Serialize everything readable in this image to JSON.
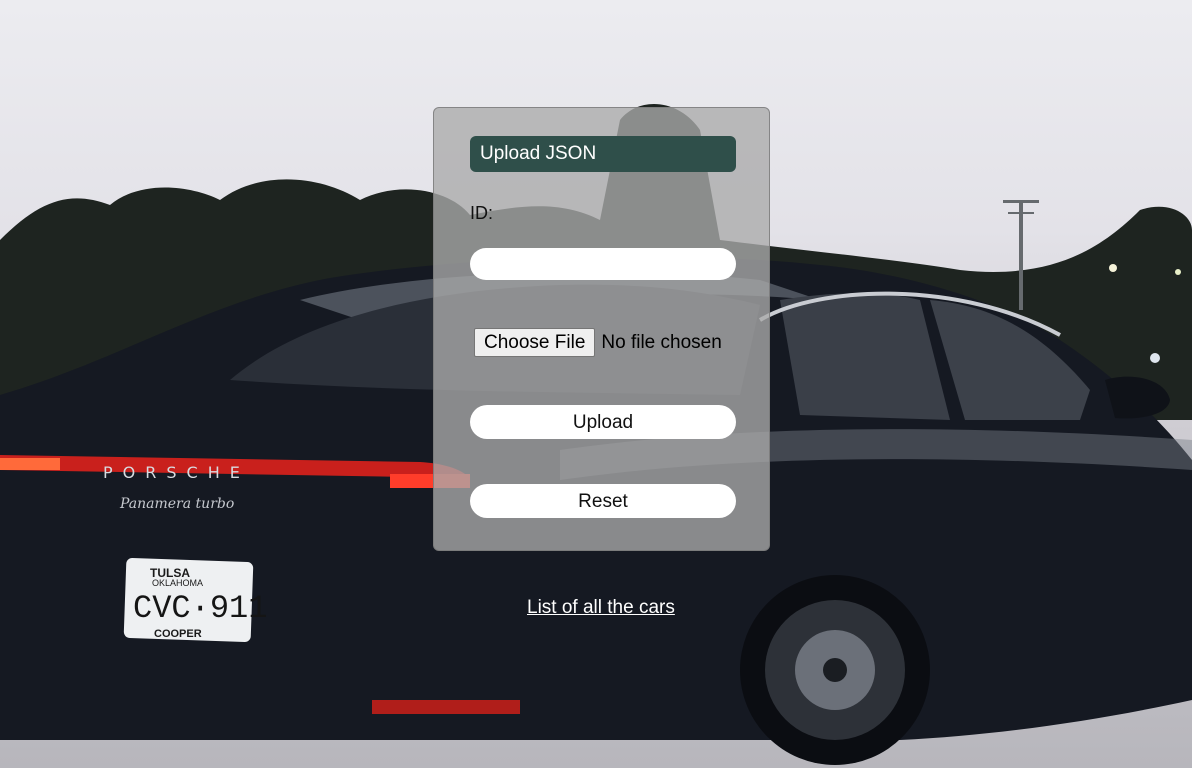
{
  "background": {
    "plate_lines": [
      "TULSA",
      "OKLAHOMA",
      "CVC·911",
      "COOPER"
    ],
    "badge": "PORSCHE",
    "model": "Panamera turbo"
  },
  "form": {
    "title": "Upload JSON",
    "id_label": "ID:",
    "id_value": "",
    "file_button": "Choose File",
    "file_status": "No file chosen",
    "upload_label": "Upload",
    "reset_label": "Reset"
  },
  "footer": {
    "cars_link": "List of all the cars"
  },
  "colors": {
    "title_bg": "#2f4f4a",
    "card_bg": "#aaaaaa",
    "link": "#ffffff"
  }
}
